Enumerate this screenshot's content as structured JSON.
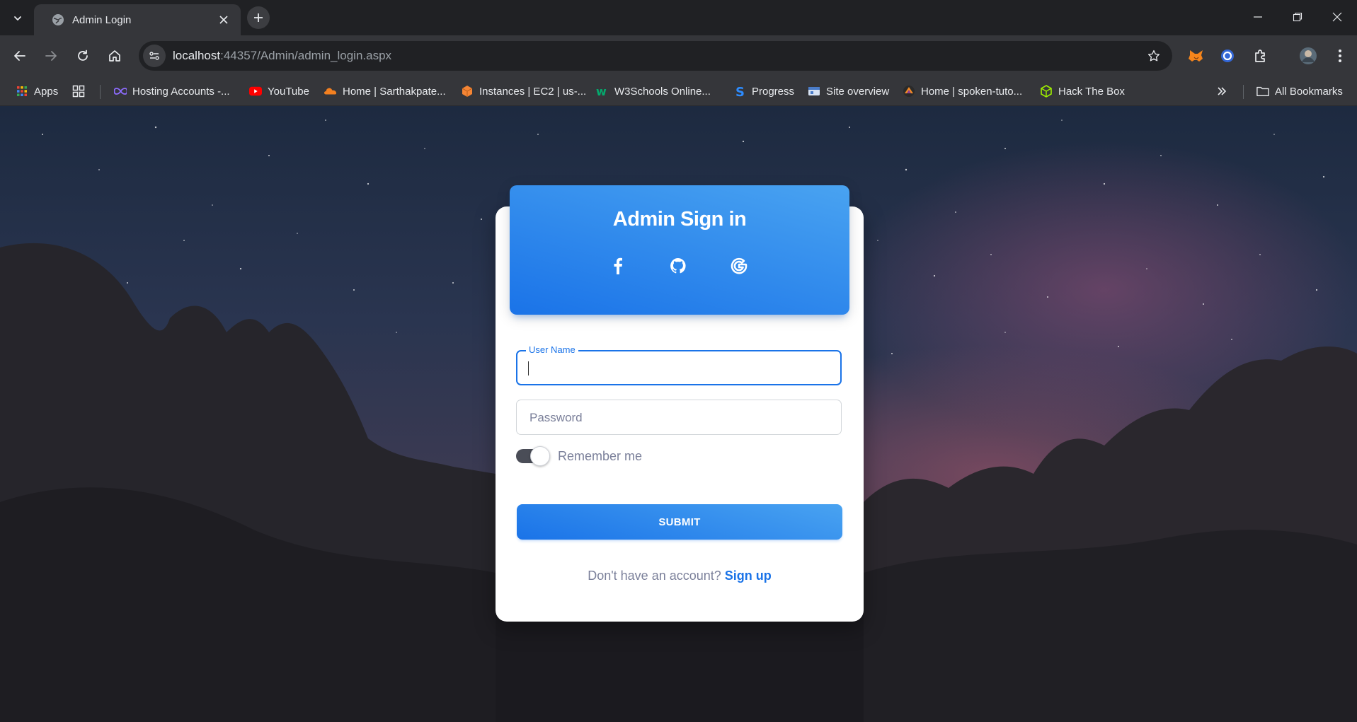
{
  "browser": {
    "tab": {
      "title": "Admin Login"
    },
    "address": {
      "host": "localhost",
      "path": ":44357/Admin/admin_login.aspx"
    },
    "bookmarks": [
      {
        "label": "Apps",
        "icon": "apps-grid-icon"
      },
      {
        "label": "",
        "icon": "tab-groups-icon"
      },
      {
        "label": "Hosting Accounts -...",
        "icon": "infinity-icon"
      },
      {
        "label": "YouTube",
        "icon": "youtube-icon"
      },
      {
        "label": "Home | Sarthakpate...",
        "icon": "cloudflare-icon"
      },
      {
        "label": "Instances | EC2 | us-...",
        "icon": "aws-icon"
      },
      {
        "label": "W3Schools Online...",
        "icon": "w3schools-icon"
      },
      {
        "label": "Progress",
        "icon": "s-logo-icon"
      },
      {
        "label": "Site overview",
        "icon": "site-icon"
      },
      {
        "label": "Home | spoken-tuto...",
        "icon": "spoken-tutorial-icon"
      },
      {
        "label": "Hack The Box",
        "icon": "cube-icon"
      }
    ],
    "all_bookmarks": "All Bookmarks"
  },
  "login": {
    "title": "Admin Sign in",
    "social": [
      "facebook-icon",
      "github-icon",
      "google-icon"
    ],
    "username_label": "User Name",
    "password_placeholder": "Password",
    "remember_label": "Remember me",
    "remember_on": true,
    "submit_label": "SUBMIT",
    "signup_prompt": "Don't have an account?",
    "signup_link": "Sign up"
  },
  "colors": {
    "accent": "#1a73e8",
    "accent_light": "#49a3f1",
    "muted_text": "#7b809a"
  }
}
